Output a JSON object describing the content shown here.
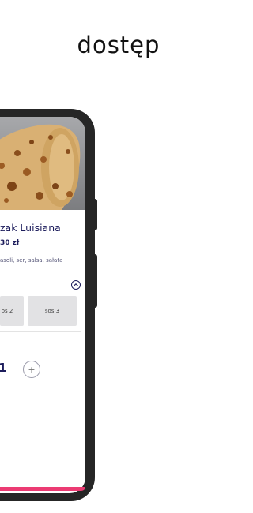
{
  "headline": "dostęp",
  "product": {
    "name": "zak Luisiana",
    "price": "30 zł",
    "ingredients": "asoli, ser, salsa, sałata"
  },
  "sauces": [
    {
      "label": "os 2"
    },
    {
      "label": "sos 3"
    }
  ],
  "quantity": {
    "value": "1",
    "plus_label": "+"
  },
  "colors": {
    "accent": "#ec3b73",
    "text_primary": "#1d1d5c",
    "frame": "#262626"
  },
  "icons": {
    "collapse": "chevron-up-icon"
  }
}
